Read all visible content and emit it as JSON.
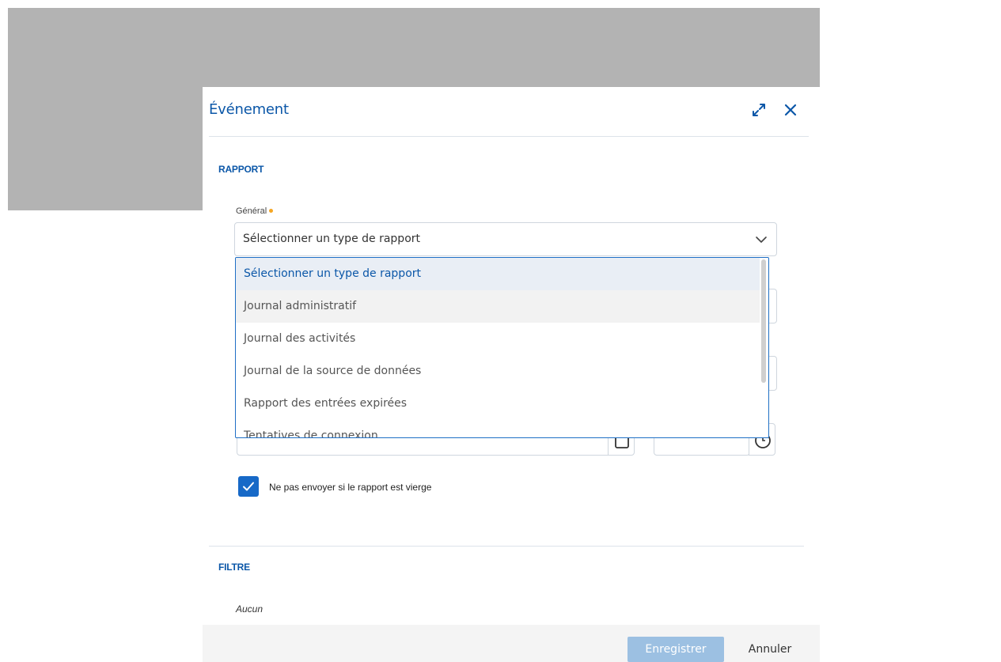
{
  "dialog": {
    "title": "Événement",
    "expand_icon": "expand-icon",
    "close_icon": "close-icon"
  },
  "sections": {
    "rapport": "RAPPORT",
    "filtre": "FILTRE"
  },
  "general_field": {
    "label": "Général",
    "selected_value": "Sélectionner un type de rapport",
    "required": true
  },
  "dropdown": {
    "options": [
      "Sélectionner un type de rapport",
      "Journal administratif",
      "Journal des activités",
      "Journal de la source de données",
      "Rapport des entrées expirées",
      "Tentatives de connexion"
    ]
  },
  "checkbox": {
    "label": "Ne pas envoyer si le rapport est vierge",
    "checked": true
  },
  "filter": {
    "empty_text": "Aucun"
  },
  "footer": {
    "save_label": "Enregistrer",
    "cancel_label": "Annuler"
  },
  "colors": {
    "accent": "#0b57a8",
    "checkbox": "#1769c7",
    "save_disabled": "#9cc0e2",
    "required_dot": "#f5a623",
    "backdrop": "#b3b3b3"
  }
}
